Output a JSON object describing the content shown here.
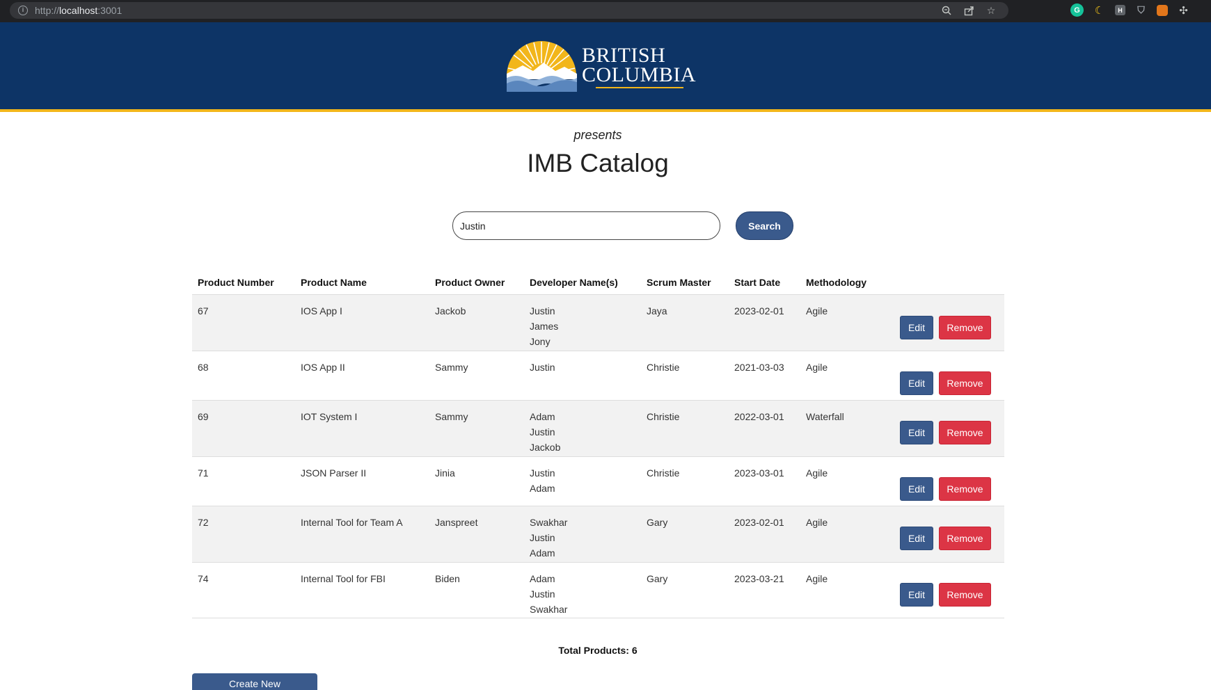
{
  "browser": {
    "url_scheme": "http://",
    "url_host": "localhost",
    "url_port": ":3001"
  },
  "header": {
    "logo_line1": "BRITISH",
    "logo_line2": "COLUMBIA",
    "colors": {
      "banner": "#0d3466",
      "accent": "#f2b61b"
    }
  },
  "main": {
    "presents": "presents",
    "title": "IMB Catalog"
  },
  "search": {
    "value": "Justin",
    "button_label": "Search"
  },
  "table": {
    "columns": [
      "Product Number",
      "Product Name",
      "Product Owner",
      "Developer Name(s)",
      "Scrum Master",
      "Start Date",
      "Methodology"
    ],
    "rows": [
      {
        "number": "67",
        "name": "IOS App I",
        "owner": "Jackob",
        "developers": [
          "Justin",
          "James",
          "Jony"
        ],
        "scrum": "Jaya",
        "start": "2023-02-01",
        "method": "Agile"
      },
      {
        "number": "68",
        "name": "IOS App II",
        "owner": "Sammy",
        "developers": [
          "Justin"
        ],
        "scrum": "Christie",
        "start": "2021-03-03",
        "method": "Agile"
      },
      {
        "number": "69",
        "name": "IOT System I",
        "owner": "Sammy",
        "developers": [
          "Adam",
          "Justin",
          "Jackob"
        ],
        "scrum": "Christie",
        "start": "2022-03-01",
        "method": "Waterfall"
      },
      {
        "number": "71",
        "name": "JSON Parser II",
        "owner": "Jinia",
        "developers": [
          "Justin",
          "Adam"
        ],
        "scrum": "Christie",
        "start": "2023-03-01",
        "method": "Agile"
      },
      {
        "number": "72",
        "name": "Internal Tool for Team A",
        "owner": "Janspreet",
        "developers": [
          "Swakhar",
          "Justin",
          "Adam"
        ],
        "scrum": "Gary",
        "start": "2023-02-01",
        "method": "Agile"
      },
      {
        "number": "74",
        "name": "Internal Tool for FBI",
        "owner": "Biden",
        "developers": [
          "Adam",
          "Justin",
          "Swakhar"
        ],
        "scrum": "Gary",
        "start": "2023-03-21",
        "method": "Agile"
      }
    ],
    "edit_label": "Edit",
    "remove_label": "Remove"
  },
  "footer": {
    "total_label": "Total Products: 6",
    "create_label": "Create New"
  }
}
